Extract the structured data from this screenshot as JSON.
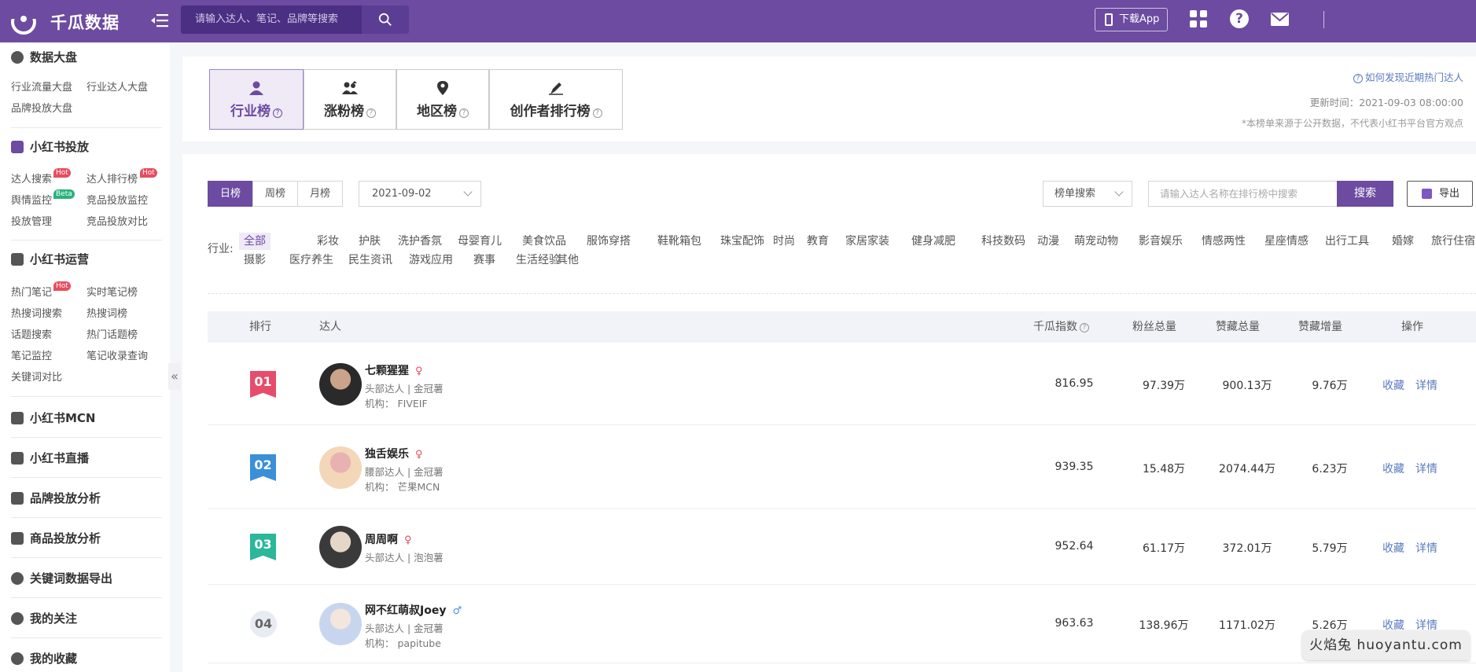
{
  "header": {
    "brand": "千瓜数据",
    "search_placeholder": "请输入达人、笔记、品牌等搜索",
    "download_app": "下载App",
    "help_glyph": "?",
    "accent": "#6c4ba0"
  },
  "sidebar": {
    "sections": {
      "dashboard": {
        "title": "数据大盘",
        "items": [
          "行业流量大盘",
          "行业达人大盘",
          "品牌投放大盘"
        ]
      },
      "xhs_ads": {
        "title": "小红书投放",
        "items": [
          "达人搜索",
          "达人排行榜",
          "舆情监控",
          "竞品投放监控",
          "投放管理",
          "竞品投放对比"
        ]
      },
      "xhs_ops": {
        "title": "小红书运营",
        "items": [
          "热门笔记",
          "实时笔记榜",
          "热搜词搜索",
          "热搜词榜",
          "话题搜索",
          "热门话题榜",
          "笔记监控",
          "笔记收录查询",
          "关键词对比"
        ]
      },
      "mcn": {
        "title": "小红书MCN"
      },
      "live": {
        "title": "小红书直播"
      },
      "brand": {
        "title": "品牌投放分析"
      },
      "goods": {
        "title": "商品投放分析"
      },
      "keyword": {
        "title": "关键词数据导出"
      },
      "follow": {
        "title": "我的关注"
      },
      "fav": {
        "title": "我的收藏"
      }
    },
    "badges": {
      "hot": "Hot",
      "beta": "Beta"
    },
    "collapse_glyph": "«"
  },
  "rank_tabs": [
    {
      "label": "行业榜"
    },
    {
      "label": "涨粉榜"
    },
    {
      "label": "地区榜"
    },
    {
      "label": "创作者排行榜"
    }
  ],
  "info": {
    "howto": "如何发现近期热门达人",
    "update_time": "更新时间：2021-09-03 08:00:00",
    "note": "*本榜单来源于公开数据，不代表小红书平台官方观点"
  },
  "filters": {
    "periods": [
      "日榜",
      "周榜",
      "月榜"
    ],
    "date": "2021-09-02",
    "list_search_type": "榜单搜索",
    "search_placeholder": "请输入达人名称在排行榜中搜索",
    "search_button": "搜索",
    "export_button": "导出",
    "industry_label": "行业:",
    "industries": [
      "全部",
      "彩妆",
      "护肤",
      "洗护香氛",
      "母婴育儿",
      "美食饮品",
      "服饰穿搭",
      "鞋靴箱包",
      "珠宝配饰",
      "时尚",
      "教育",
      "家居家装",
      "健身减肥",
      "科技数码",
      "动漫",
      "萌宠动物",
      "影音娱乐",
      "情感两性",
      "星座情感",
      "出行工具",
      "婚嫁",
      "旅行住宿",
      "摄影",
      "医疗养生",
      "民生资讯",
      "游戏应用",
      "赛事",
      "生活经验",
      "其他"
    ]
  },
  "table": {
    "headers": {
      "rank": "排行",
      "talent": "达人",
      "index": "千瓜指数",
      "fans": "粉丝总量",
      "likes": "赞藏总量",
      "likes_inc": "赞藏增量",
      "ops": "操作"
    },
    "collect_label": "收藏",
    "detail_label": "详情",
    "rows": [
      {
        "rank": "01",
        "name": "七颗猩猩",
        "gender": "♀",
        "tags": "头部达人 | 金冠薯",
        "org": "机构：  FIVEIF",
        "index": "816.95",
        "fans": "97.39万",
        "likes": "900.13万",
        "likes_inc": "9.76万",
        "flag_color": "#e84c6c"
      },
      {
        "rank": "02",
        "name": "独舌娱乐",
        "gender": "♀",
        "tags": "腰部达人 | 金冠薯",
        "org": "机构：  芒果MCN",
        "index": "939.35",
        "fans": "15.48万",
        "likes": "2074.44万",
        "likes_inc": "6.23万",
        "flag_color": "#3a8fd8"
      },
      {
        "rank": "03",
        "name": "周周啊",
        "gender": "♀",
        "tags": "头部达人 | 泡泡薯",
        "org": "",
        "index": "952.64",
        "fans": "61.17万",
        "likes": "372.01万",
        "likes_inc": "5.79万",
        "flag_color": "#2bb79a"
      },
      {
        "rank": "04",
        "name": "网不红萌叔Joey",
        "gender": "♂",
        "tags": "头部达人 | 金冠薯",
        "org": "机构：  papitube",
        "index": "963.63",
        "fans": "138.96万",
        "likes": "1171.02万",
        "likes_inc": "5.26万",
        "flag_color": ""
      }
    ]
  },
  "watermark": "火焰兔 huoyantu.com"
}
